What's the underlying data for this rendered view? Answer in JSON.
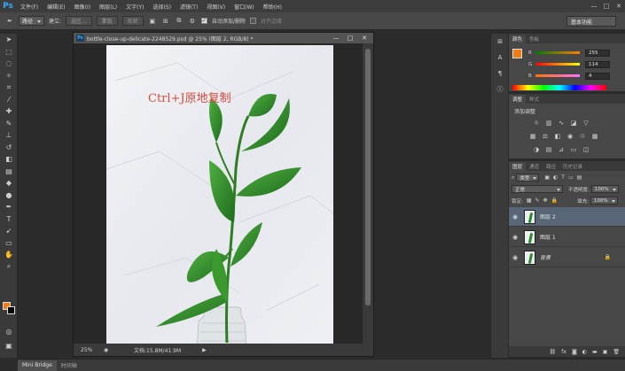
{
  "app": {
    "logo": "Ps"
  },
  "menu": [
    "文件(F)",
    "编辑(E)",
    "图像(I)",
    "图层(L)",
    "文字(Y)",
    "选择(S)",
    "滤镜(T)",
    "视图(V)",
    "窗口(W)",
    "帮助(H)"
  ],
  "window_controls": {
    "minimize": "—",
    "restore": "□",
    "close": "✕"
  },
  "options": {
    "mode_select": "路径",
    "build_label": "建立:",
    "selection_btn": "选区...",
    "mask_btn": "蒙版",
    "shape_btn": "形状",
    "auto_add_delete": "自动添加/删除",
    "align_edges": "对齐边缘",
    "workspace": "基本功能"
  },
  "document": {
    "icon": "Ps",
    "title": "bottle-close-up-delicate-2248529.psd @ 25% (图层 2, RGB/8) *",
    "caption": "Ctrl+J原地复制",
    "zoom": "25%",
    "doc_info": "文档:15.8M/41.9M",
    "controls": {
      "minimize": "—",
      "maximize": "□",
      "close": "✕"
    }
  },
  "color_panel": {
    "tabs": [
      "颜色",
      "色板"
    ],
    "sliders": [
      {
        "label": "R",
        "value": "255",
        "gradient": "#ff0000"
      },
      {
        "label": "G",
        "value": "114",
        "gradient": "#00ff00"
      },
      {
        "label": "B",
        "value": "4",
        "gradient": "#0000ff"
      }
    ],
    "foreground": "#f07d14",
    "background": "#000000"
  },
  "adjustments_panel": {
    "tabs": [
      "调整",
      "样式"
    ],
    "title": "添加调整"
  },
  "layers_panel": {
    "tabs": [
      "图层",
      "通道",
      "路径",
      "历史记录"
    ],
    "filter_select": "类型",
    "blend_mode": "正常",
    "opacity_label": "不透明度:",
    "opacity": "100%",
    "lock_label": "锁定:",
    "fill_label": "填充:",
    "fill": "100%",
    "layers": [
      {
        "name": "图层 2",
        "selected": true
      },
      {
        "name": "图层 1",
        "selected": false
      },
      {
        "name": "背景",
        "selected": false,
        "locked": true
      }
    ]
  },
  "bottom_tabs": [
    "Mini Bridge",
    "时间轴"
  ],
  "colors": {
    "accent": "#31a8ff",
    "selected_layer": "#596678",
    "caption": "#d24b3c"
  }
}
